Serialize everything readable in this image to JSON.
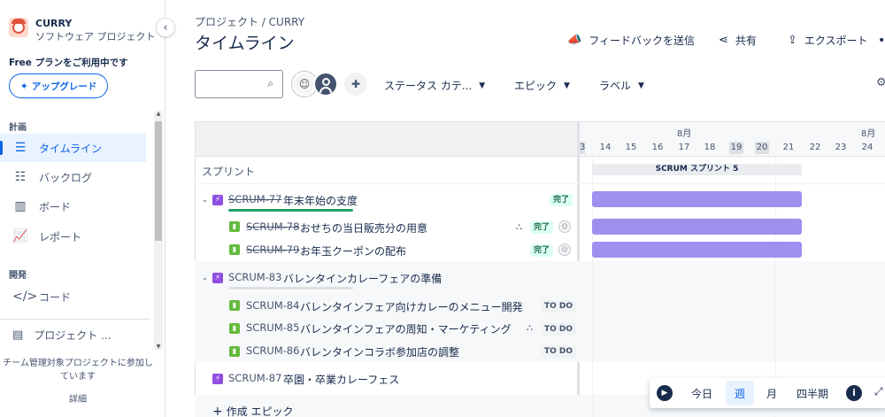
{
  "project": {
    "name": "CURRY",
    "type": "ソフトウェア プロジェクト"
  },
  "sidebar": {
    "free_text": "Free プランをご利用中です",
    "upgrade_label": "アップグレード",
    "section_plan": "計画",
    "section_dev": "開発",
    "items": [
      {
        "label": "タイムライン",
        "icon": "timeline-icon"
      },
      {
        "label": "バックログ",
        "icon": "backlog-icon"
      },
      {
        "label": "ボード",
        "icon": "board-icon"
      },
      {
        "label": "レポート",
        "icon": "report-icon"
      },
      {
        "label": "コード",
        "icon": "code-icon"
      }
    ],
    "project_link": "プロジェクト ...",
    "team_message": "チーム管理対象プロジェクトに参加しています",
    "detail_link": "詳細"
  },
  "header": {
    "breadcrumb": "プロジェクト  /  CURRY",
    "title": "タイムライン",
    "feedback": "フィードバックを送信",
    "share": "共有",
    "export": "エクスポート",
    "more": "•"
  },
  "filters": {
    "search_placeholder": "",
    "status_category": "ステータス カテ...",
    "epic": "エピック",
    "label": "ラベル"
  },
  "timeline": {
    "months": [
      "8月",
      "8月"
    ],
    "clipped_day": "3",
    "days": [
      "14",
      "15",
      "16",
      "17",
      "18",
      "19",
      "20",
      "21",
      "22",
      "23",
      "24"
    ],
    "sprint_row_label": "スプリント",
    "sprint_name": "SCRUM スプリント 5",
    "rows": [
      {
        "key": "SCRUM-77",
        "summary": "年末年始の支度",
        "status": "完了"
      },
      {
        "key": "SCRUM-78",
        "summary": "おせちの当日販売分の用意",
        "status": "完了"
      },
      {
        "key": "SCRUM-79",
        "summary": "お年玉クーポンの配布",
        "status": "完了"
      },
      {
        "key": "SCRUM-83",
        "summary": "バレンタインカレーフェアの準備",
        "status": ""
      },
      {
        "key": "SCRUM-84",
        "summary": "バレンタインフェア向けカレーのメニュー開発",
        "status": "TO DO"
      },
      {
        "key": "SCRUM-85",
        "summary": "バレンタインフェアの周知・マーケティング",
        "status": "TO DO"
      },
      {
        "key": "SCRUM-86",
        "summary": "バレンタインコラボ参加店の調整",
        "status": "TO DO"
      },
      {
        "key": "SCRUM-87",
        "summary": "卒園・卒業カレーフェス",
        "status": ""
      }
    ],
    "create_epic": "作成 エピック"
  },
  "zoom": {
    "today": "今日",
    "week": "週",
    "month": "月",
    "quarter": "四半期",
    "selected": "週"
  },
  "colors": {
    "accent": "#0c66e4",
    "epic": "#904ee2",
    "story": "#63ba3c",
    "bar": "#9f8fef",
    "done_progress": "#22a06b"
  }
}
